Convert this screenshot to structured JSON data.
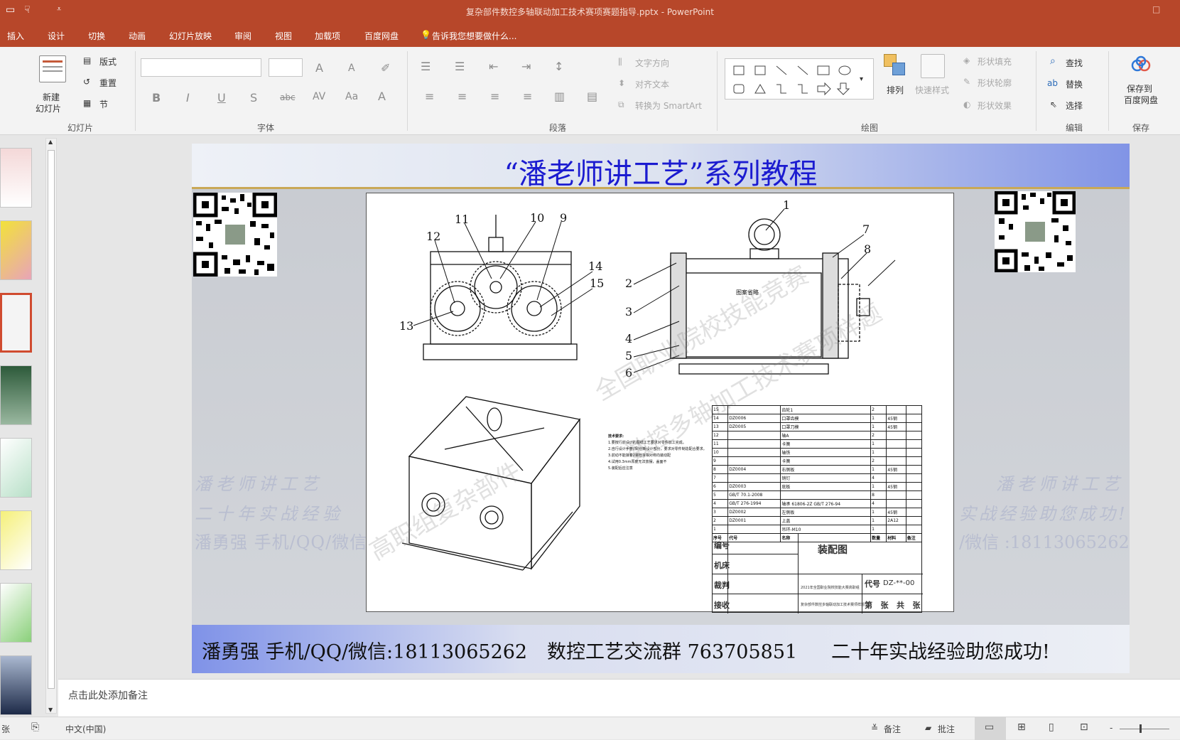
{
  "window": {
    "title": "复杂部件数控多轴联动加工技术赛项赛题指导.pptx - PowerPoint"
  },
  "ribbon_tabs": [
    "插入",
    "设计",
    "切换",
    "动画",
    "幻灯片放映",
    "审阅",
    "视图",
    "加载项",
    "百度网盘"
  ],
  "tell_me": "告诉我您想要做什么...",
  "ribbon": {
    "slides_group": {
      "label": "幻灯片",
      "new_slide": "新建\n幻灯片",
      "new_slide_line1": "新建",
      "new_slide_line2": "幻灯片",
      "layout": "版式",
      "reset": "重置",
      "section": "节"
    },
    "font_group": {
      "label": "字体"
    },
    "paragraph_group": {
      "label": "段落",
      "text_direction": "文字方向",
      "align_text": "对齐文本",
      "convert_smartart": "转换为 SmartArt"
    },
    "drawing_group": {
      "label": "绘图",
      "arrange": "排列",
      "quick_styles": "快速样式",
      "shape_fill": "形状填充",
      "shape_outline": "形状轮廓",
      "shape_effects": "形状效果"
    },
    "editing_group": {
      "label": "编辑",
      "find": "查找",
      "replace": "替换",
      "select": "选择"
    },
    "save_group": {
      "label": "保存",
      "save_to_baidu_line1": "保存到",
      "save_to_baidu_line2": "百度网盘"
    }
  },
  "slide": {
    "title": "“潘老师讲工艺”系列教程",
    "watermark_left": [
      "潘老师讲工艺",
      "二十年实战经验",
      "潘勇强 手机/QQ/微信"
    ],
    "watermark_right": [
      "潘老师讲工艺",
      "实战经验助您成功!",
      "/微信 :18113065262"
    ],
    "drawing": {
      "callouts": [
        "11",
        "10",
        "9",
        "12",
        "14",
        "15",
        "13",
        "1",
        "7",
        "8",
        "2",
        "3",
        "4",
        "5",
        "6"
      ],
      "inner_label": "图案省略",
      "tech_req_title": "技术要求:",
      "tech_req": [
        "1.要按行前设计的图纸工艺要求对零件加工完成。",
        "2.自行设计手册(相)创新设计部分，要求对零件制造配合要求。",
        "3.前动不能接着2螺栓拆相对称向装动配",
        "4.试用0.3mm厚度无法放摆，盖面不",
        "5.装配后应注意"
      ],
      "bom": [
        [
          "15",
          "",
          "齿轮1",
          "2",
          ""
        ],
        [
          "14",
          "DZ0006",
          "口罩齿模",
          "1",
          "45钢"
        ],
        [
          "13",
          "DZ0005",
          "口罩刀模",
          "1",
          "45钢"
        ],
        [
          "12",
          "",
          "轴A",
          "2",
          ""
        ],
        [
          "11",
          "",
          "卡簧",
          "1",
          ""
        ],
        [
          "10",
          "",
          "轴铁",
          "1",
          ""
        ],
        [
          "9",
          "",
          "卡簧",
          "2",
          ""
        ],
        [
          "8",
          "DZ0004",
          "右侧板",
          "1",
          "45钢"
        ],
        [
          "7",
          "",
          "销钉",
          "4",
          ""
        ],
        [
          "6",
          "DZ0003",
          "底板",
          "1",
          "45钢"
        ],
        [
          "5",
          "GB/T 70.1-2008",
          "",
          "8",
          ""
        ],
        [
          "4",
          "GB/T 276-1994",
          "轴承 61806-2Z GB/T 276-94",
          "4",
          ""
        ],
        [
          "3",
          "DZ0002",
          "左侧板",
          "1",
          "45钢"
        ],
        [
          "2",
          "DZ0001",
          "上盖",
          "1",
          "2A12"
        ],
        [
          "1",
          "",
          "吊环-M10",
          "1",
          ""
        ]
      ],
      "bom_header": [
        "序号",
        "代号",
        "名称",
        "数量",
        "材料",
        "备注"
      ],
      "title_block": {
        "rows": [
          "编号",
          "机床",
          "裁判",
          "接收"
        ],
        "name": "装配图",
        "line1": "2021年全国职业院校技能大赛高职组",
        "line2": "复杂部件数控多轴联动加工技术赛项样题",
        "code_label": "代号",
        "code": "DZ-**-00",
        "sheet": "第   张   共   张"
      },
      "diagonal_watermark_1": "全国职业院校技能竞赛",
      "diagonal_watermark_2": "数控多轴加工技术赛项样题",
      "diagonal_watermark_3": "高职组复杂部件"
    },
    "footer": {
      "contact": "潘勇强 手机/QQ/微信:18113065262",
      "group": "数控工艺交流群 763705851",
      "slogan": "二十年实战经验助您成功!"
    }
  },
  "notes": {
    "placeholder": "点击此处添加备注"
  },
  "statusbar": {
    "slide_info": "张",
    "language": "中文(中国)",
    "notes": "备注",
    "comments": "批注",
    "zoom_minus": "-"
  },
  "colors": {
    "accent": "#b7472a",
    "slide_title": "#1b1bd0",
    "selected_thumb": "#d04b2f"
  }
}
